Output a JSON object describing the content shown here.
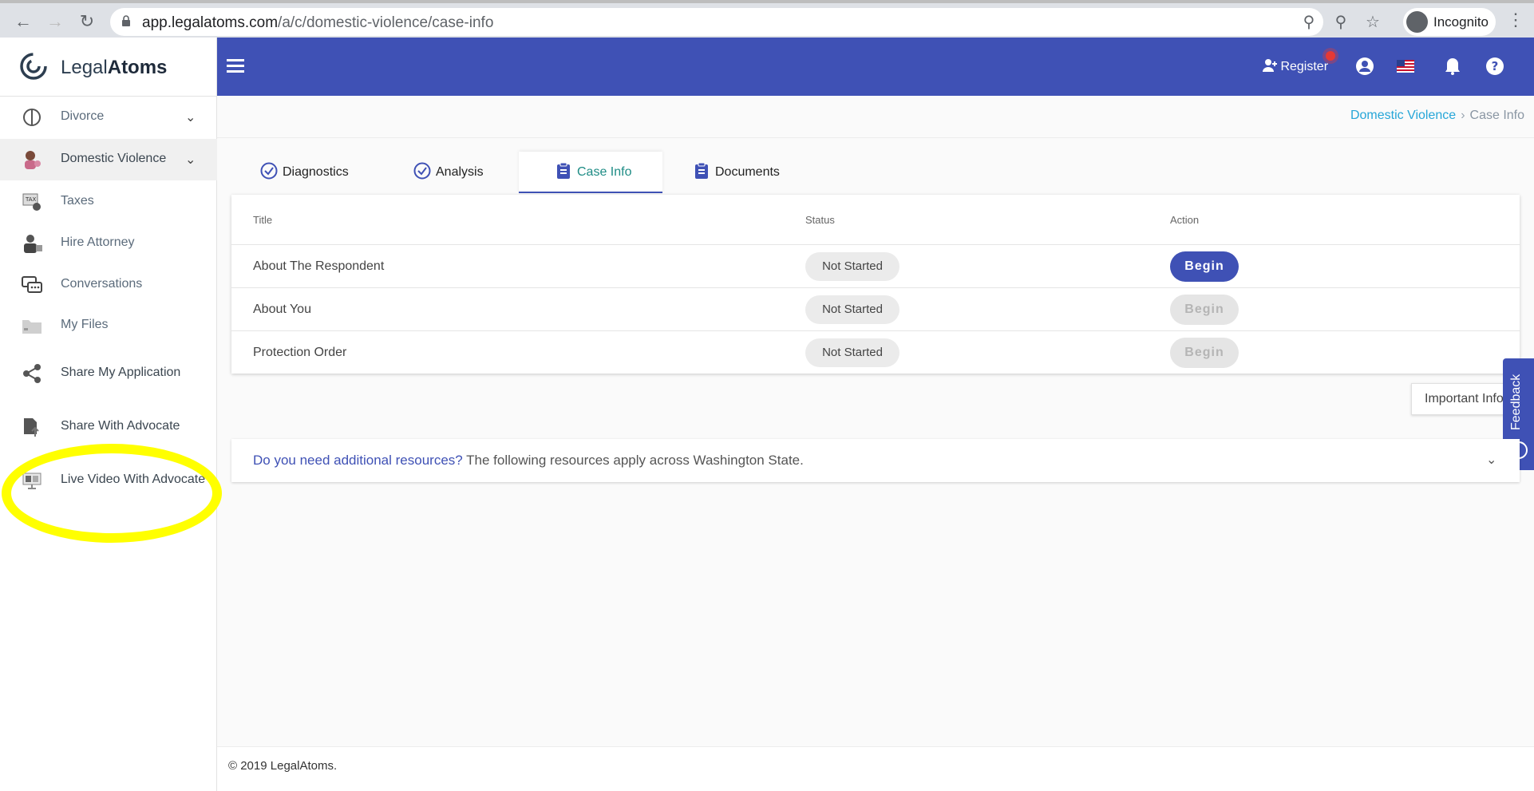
{
  "browser": {
    "url_domain": "app.legalatoms.com",
    "url_path": "/a/c/domestic-violence/case-info",
    "incognito_label": "Incognito"
  },
  "sidebar": {
    "logo_light": "Legal",
    "logo_bold": "Atoms",
    "items": [
      {
        "label": "Divorce",
        "icon": "divorce-icon"
      },
      {
        "label": "Domestic Violence",
        "icon": "domestic-violence-icon"
      },
      {
        "label": "Taxes",
        "icon": "taxes-icon"
      },
      {
        "label": "Hire Attorney",
        "icon": "attorney-icon"
      },
      {
        "label": "Conversations",
        "icon": "conversations-icon"
      },
      {
        "label": "My Files",
        "icon": "folder-icon"
      },
      {
        "label": "Share My Application",
        "icon": "share-icon"
      },
      {
        "label": "Share With Advocate",
        "icon": "document-upload-icon"
      },
      {
        "label": "Live Video With Advocate",
        "icon": "video-icon"
      }
    ]
  },
  "topbar": {
    "register_label": "Register"
  },
  "breadcrumb": {
    "parent": "Domestic Violence",
    "separator": "›",
    "current": "Case Info"
  },
  "tabs": [
    {
      "label": "Diagnostics",
      "icon": "check-circle-icon"
    },
    {
      "label": "Analysis",
      "icon": "check-circle-icon"
    },
    {
      "label": "Case Info",
      "icon": "clipboard-icon",
      "active": true
    },
    {
      "label": "Documents",
      "icon": "clipboard-icon"
    }
  ],
  "table": {
    "headers": {
      "title": "Title",
      "status": "Status",
      "action": "Action"
    },
    "rows": [
      {
        "title": "About The Respondent",
        "status": "Not Started",
        "action": "Begin",
        "enabled": true
      },
      {
        "title": "About You",
        "status": "Not Started",
        "action": "Begin",
        "enabled": false
      },
      {
        "title": "Protection Order",
        "status": "Not Started",
        "action": "Begin",
        "enabled": false
      }
    ]
  },
  "important_info_label": "Important Info",
  "feedback_label": "Feedback",
  "resources": {
    "question": "Do you need additional resources?",
    "text": " The following resources apply across Washington State."
  },
  "footer": {
    "copyright": "© 2019 LegalAtoms."
  },
  "colors": {
    "primary": "#3f51b5",
    "link": "#26a6d8",
    "active_tab_text": "#1e8c85",
    "highlight": "#ffff00"
  }
}
